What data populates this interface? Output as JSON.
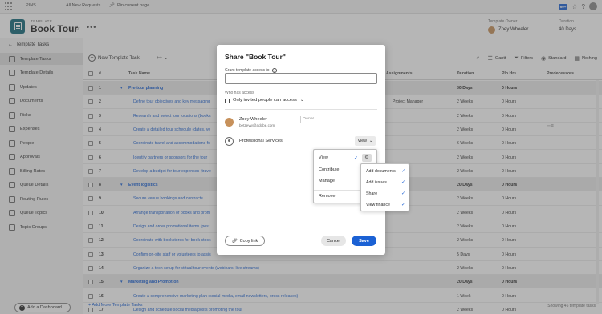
{
  "pins": {
    "label": "PINS",
    "all_requests": "All New Requests",
    "pin_current": "Pin current page",
    "badge": "60+"
  },
  "header": {
    "type_label": "TEMPLATE",
    "title": "Book Tour",
    "owner_label": "Template Owner",
    "owner_name": "Zoey Wheeler",
    "duration_label": "Duration",
    "duration_value": "40 Days"
  },
  "sidebar": {
    "back_label": "Template Tasks",
    "items": [
      {
        "label": "Template Tasks"
      },
      {
        "label": "Template Details"
      },
      {
        "label": "Updates"
      },
      {
        "label": "Documents"
      },
      {
        "label": "Risks"
      },
      {
        "label": "Expenses"
      },
      {
        "label": "People"
      },
      {
        "label": "Approvals"
      },
      {
        "label": "Billing Rates"
      },
      {
        "label": "Queue Details"
      },
      {
        "label": "Routing Rules"
      },
      {
        "label": "Queue Topics"
      },
      {
        "label": "Topic Groups"
      }
    ],
    "add_dashboard": "Add a Dashboard"
  },
  "toolbar": {
    "new_task": "New Template Task",
    "gantt": "Gantt",
    "filters": "Filters",
    "standard": "Standard",
    "nothing": "Nothing"
  },
  "table": {
    "headers": {
      "num": "#",
      "task": "Task Name",
      "assign": "Assignments",
      "duration": "Duration",
      "plan": "Pln Hrs",
      "pred": "Predecessors"
    },
    "rows": [
      {
        "num": "1",
        "name": "Pre-tour planning",
        "group": true,
        "assign": "",
        "duration": "30 Days",
        "plan": "0 Hours"
      },
      {
        "num": "2",
        "name": "Define tour objectives and key messaging",
        "group": false,
        "assign": "Project Manager",
        "duration": "2 Weeks",
        "plan": "0 Hours"
      },
      {
        "num": "3",
        "name": "Research and select tour locations (books",
        "group": false,
        "assign": "",
        "duration": "2 Weeks",
        "plan": "0 Hours"
      },
      {
        "num": "4",
        "name": "Create a detailed tour schedule (dates, ve",
        "group": false,
        "assign": "",
        "duration": "2 Weeks",
        "plan": "0 Hours"
      },
      {
        "num": "5",
        "name": "Coordinate travel and accommodations fo",
        "group": false,
        "assign": "",
        "duration": "6 Weeks",
        "plan": "0 Hours"
      },
      {
        "num": "6",
        "name": "Identify partners or sponsors for the tour",
        "group": false,
        "assign": "",
        "duration": "2 Weeks",
        "plan": "0 Hours"
      },
      {
        "num": "7",
        "name": "Develop a budget for tour expenses (trave",
        "group": false,
        "assign": "",
        "duration": "2 Weeks",
        "plan": "0 Hours"
      },
      {
        "num": "8",
        "name": "Event logistics",
        "group": true,
        "assign": "",
        "duration": "20 Days",
        "plan": "0 Hours"
      },
      {
        "num": "9",
        "name": "Secure venue bookings and contracts",
        "group": false,
        "assign": "",
        "duration": "2 Weeks",
        "plan": "0 Hours"
      },
      {
        "num": "10",
        "name": "Arrange transportation of books and prom",
        "group": false,
        "assign": "",
        "duration": "2 Weeks",
        "plan": "0 Hours"
      },
      {
        "num": "11",
        "name": "Design and order promotional items (post",
        "group": false,
        "assign": "",
        "duration": "2 Weeks",
        "plan": "0 Hours"
      },
      {
        "num": "12",
        "name": "Coordinate with bookstores for book stock",
        "group": false,
        "assign": "",
        "duration": "2 Weeks",
        "plan": "0 Hours"
      },
      {
        "num": "13",
        "name": "Confirm on-site staff or volunteers to assis",
        "group": false,
        "assign": "",
        "duration": "5 Days",
        "plan": "0 Hours"
      },
      {
        "num": "14",
        "name": "Organize a tech setup for virtual tour events (webinars, live streams)",
        "group": false,
        "assign": "",
        "duration": "2 Weeks",
        "plan": "0 Hours"
      },
      {
        "num": "15",
        "name": "Marketing and Promotion",
        "group": true,
        "assign": "",
        "duration": "20 Days",
        "plan": "0 Hours"
      },
      {
        "num": "16",
        "name": "Create a comprehensive marketing plan (social media, email newsletters, press releases)",
        "group": false,
        "assign": "",
        "duration": "1 Week",
        "plan": "0 Hours"
      },
      {
        "num": "17",
        "name": "Design and schedule social media posts promoting the tour",
        "group": false,
        "assign": "",
        "duration": "2 Weeks",
        "plan": "0 Hours"
      }
    ],
    "add_more": "+ Add More Template Tasks",
    "showing": "Showing 46 template tasks"
  },
  "modal": {
    "title": "Share \"Book Tour\"",
    "grant_label": "Grant template access to",
    "grant_placeholder": "",
    "who_label": "Who has access",
    "access_value": "Only invited people can access",
    "user_name": "Zoey Wheeler",
    "user_email": "betzeyw@adobe.com",
    "owner_tag": "Owner",
    "team_name": "Professional Services",
    "team_permission": "View",
    "copy_link": "Copy link",
    "cancel": "Cancel",
    "save": "Save"
  },
  "permission_menu": {
    "options": [
      "View",
      "Contribute",
      "Manage",
      "Remove"
    ]
  },
  "sub_menu": {
    "options": [
      "Add documents",
      "Add issues",
      "Share",
      "View finance"
    ]
  }
}
